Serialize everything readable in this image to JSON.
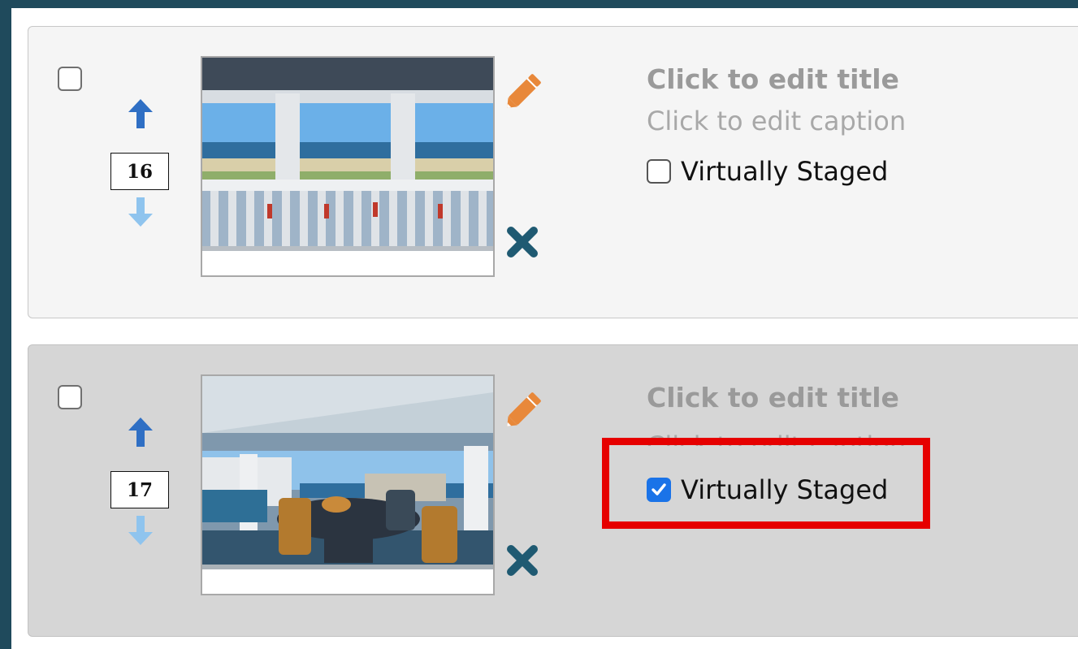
{
  "photos": [
    {
      "order": "16",
      "title_placeholder": "Click to edit title",
      "caption_placeholder": "Click to edit caption",
      "virtually_staged_label": "Virtually Staged",
      "virtually_staged": false,
      "selected": false
    },
    {
      "order": "17",
      "title_placeholder": "Click to edit title",
      "caption_placeholder": "Click to edit caption",
      "virtually_staged_label": "Virtually Staged",
      "virtually_staged": true,
      "selected": false
    }
  ],
  "icons": {
    "move_up": "arrow-up-icon",
    "move_down": "arrow-down-icon",
    "edit": "pencil-icon",
    "delete": "close-icon"
  },
  "colors": {
    "frame": "#1f4a5c",
    "pencil": "#e8883a",
    "delete": "#1f5a72",
    "arrow_up": "#2f6fc4",
    "arrow_down": "#8fc4ee",
    "highlight": "#e60000",
    "checkbox_checked": "#1a73e8"
  }
}
